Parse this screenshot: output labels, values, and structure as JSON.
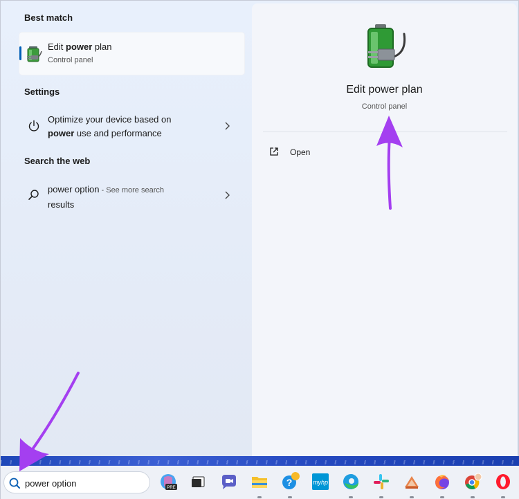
{
  "best_match": {
    "header": "Best match",
    "title_prefix": "Edit ",
    "title_bold": "power",
    "title_suffix": " plan",
    "subtitle": "Control panel"
  },
  "settings": {
    "header": "Settings",
    "line1": "Optimize your device based on",
    "line2_bold": "power",
    "line2_rest": " use and performance"
  },
  "web": {
    "header": "Search the web",
    "query": "power option",
    "suffix": " - See more search",
    "line2": "results"
  },
  "preview": {
    "title": "Edit power plan",
    "subtitle": "Control panel",
    "open_label": "Open"
  },
  "taskbar": {
    "search_value": "power option",
    "pinned_apps": [
      {
        "name": "copilot-pre-icon",
        "badge": "PRE"
      },
      {
        "name": "task-view-icon"
      },
      {
        "name": "teams-chat-icon"
      },
      {
        "name": "file-explorer-icon"
      },
      {
        "name": "get-help-icon"
      },
      {
        "name": "myhp-icon",
        "label": "myhp"
      },
      {
        "name": "edge-icon"
      },
      {
        "name": "slack-icon"
      },
      {
        "name": "app-unknown-icon"
      },
      {
        "name": "firefox-icon"
      },
      {
        "name": "chrome-icon"
      },
      {
        "name": "opera-icon"
      }
    ]
  },
  "colors": {
    "accent": "#005fb8",
    "annotation_arrow": "#a43ff0"
  }
}
